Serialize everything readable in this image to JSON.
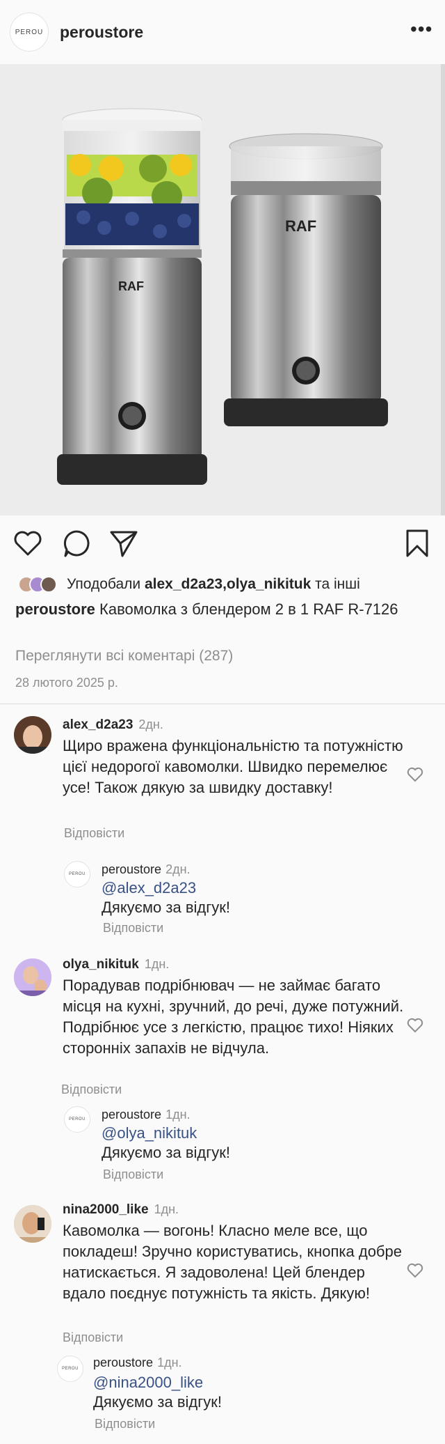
{
  "header": {
    "username": "peroustore",
    "logo_text": "PEROU",
    "more_label": "•••"
  },
  "actions": {
    "like": "heart-icon",
    "comment": "comment-icon",
    "share": "send-icon",
    "save": "bookmark-icon"
  },
  "likes": {
    "prefix": "Уподобали ",
    "users": "alex_d2a23,olya_nikituk",
    "suffix": " та інші"
  },
  "caption": {
    "author": "peroustore",
    "text": " Кавомолка з блендером 2 в 1 RAF R-7126"
  },
  "view_all": "Переглянути всі коментарі (287)",
  "date": "28 лютого 2025 р.",
  "image_brand": "RAF",
  "comments": [
    {
      "user": "alex_d2a23",
      "ago": "2дн.",
      "text": "Щиро вражена функціональністю та потужністю цієї недорогої кавомолки. Швидко перемелює усе! Також дякую за швидку доставку!",
      "reply_label": "Відповісти",
      "store_reply": {
        "user": "peroustore",
        "ago": "2дн.",
        "mention": "@alex_d2a23",
        "text": "Дякуємо за відгук!",
        "reply_label": "Відповісти"
      }
    },
    {
      "user": "olya_nikituk",
      "ago": "1дн.",
      "text": "Порадував подрібнювач — не займає багато місця на кухні, зручний, до речі, дуже потужний. Подрібнює усе з легкістю, працює тихо! Ніяких сторонніх запахів не відчула.",
      "reply_label": "Відповісти",
      "store_reply": {
        "user": "peroustore",
        "ago": "1дн.",
        "mention": "@olya_nikituk",
        "text": "Дякуємо за відгук!",
        "reply_label": "Відповісти"
      }
    },
    {
      "user": "nina2000_like",
      "ago": "1дн.",
      "text": "Кавомолка — вогонь! Класно меле все, що покладеш! Зручно користуватись, кнопка добре натискається. Я задоволена! Цей блендер вдало поєднує потужність та якість. Дякую!",
      "reply_label": "Відповісти",
      "store_reply": {
        "user": "peroustore",
        "ago": "1дн.",
        "mention": "@nina2000_like",
        "text": "Дякуємо за відгук!",
        "reply_label": "Відповісти"
      }
    }
  ]
}
